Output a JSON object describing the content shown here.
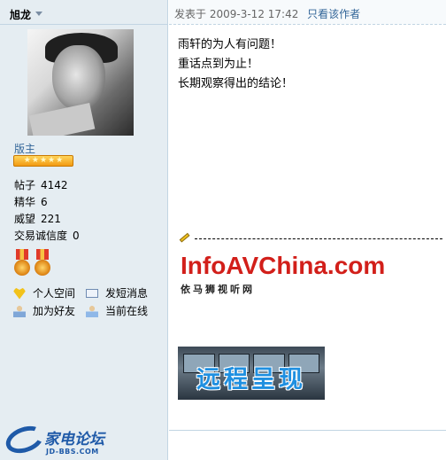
{
  "author": {
    "name": "旭龙",
    "role": "版主",
    "stats": [
      {
        "label": "帖子",
        "value": "4142"
      },
      {
        "label": "精华",
        "value": "6"
      },
      {
        "label": "威望",
        "value": "221"
      },
      {
        "label": "交易诚信度",
        "value": "0"
      }
    ],
    "star_count": 5,
    "actions": {
      "space": "个人空间",
      "message": "发短消息",
      "add_friend": "加为好友",
      "online": "当前在线"
    }
  },
  "post": {
    "meta_prefix": "发表于",
    "timestamp": "2009-3-12 17:42",
    "only_author": "只看该作者",
    "lines": [
      "雨轩的为人有问题！",
      "重话点到为止！",
      "长期观察得出的结论！"
    ]
  },
  "signature": {
    "infoav_logo": "InfoAVChina.com",
    "infoav_sub": "依马狮视听网",
    "remote_banner": "远程呈现"
  },
  "forum_logo": {
    "name": "家电论坛",
    "url": "JD-BBS.COM"
  },
  "colors": {
    "sidebar_bg": "#e5edf2",
    "link": "#336699",
    "accent_red": "#d21f1a",
    "brand_blue": "#1f5aa8"
  }
}
